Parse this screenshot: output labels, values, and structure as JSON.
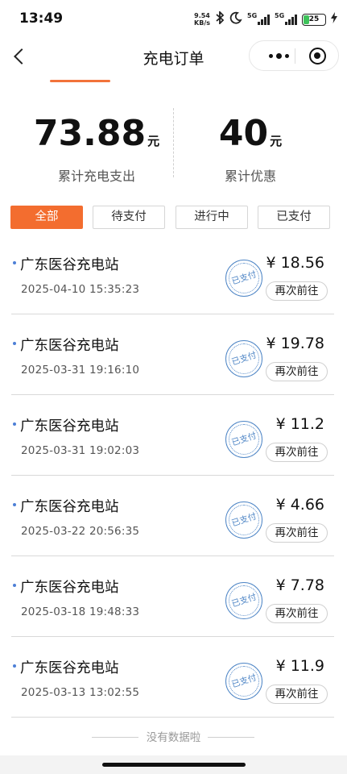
{
  "status_bar": {
    "time": "13:49",
    "net_speed_value": "9.54",
    "net_speed_unit": "KB/s",
    "icons": [
      "bluetooth-icon",
      "moon-icon",
      "signal-icon",
      "signal-icon",
      "battery-icon",
      "charging-icon"
    ],
    "signal_1_label": "5G",
    "signal_2_label": "5G",
    "battery_level": "25"
  },
  "nav": {
    "title": "充电订单"
  },
  "summary": {
    "total_spend_value": "73.88",
    "total_spend_unit": "元",
    "total_spend_label": "累计充电支出",
    "total_discount_value": "40",
    "total_discount_unit": "元",
    "total_discount_label": "累计优惠"
  },
  "filters": {
    "all": "全部",
    "pending_payment": "待支付",
    "in_progress": "进行中",
    "paid": "已支付",
    "active": "全部"
  },
  "colors": {
    "accent": "#f36d2f",
    "stamp": "#4f86c6",
    "dot": "#4d7fd6"
  },
  "orders": [
    {
      "station": "广东医谷充电站",
      "time": "2025-04-10 15:35:23",
      "stamp": "已支付",
      "price": "¥ 18.56",
      "action": "再次前往"
    },
    {
      "station": "广东医谷充电站",
      "time": "2025-03-31 19:16:10",
      "stamp": "已支付",
      "price": "¥ 19.78",
      "action": "再次前往"
    },
    {
      "station": "广东医谷充电站",
      "time": "2025-03-31 19:02:03",
      "stamp": "已支付",
      "price": "¥ 11.2",
      "action": "再次前往"
    },
    {
      "station": "广东医谷充电站",
      "time": "2025-03-22 20:56:35",
      "stamp": "已支付",
      "price": "¥ 4.66",
      "action": "再次前往"
    },
    {
      "station": "广东医谷充电站",
      "time": "2025-03-18 19:48:33",
      "stamp": "已支付",
      "price": "¥ 7.78",
      "action": "再次前往"
    },
    {
      "station": "广东医谷充电站",
      "time": "2025-03-13 13:02:55",
      "stamp": "已支付",
      "price": "¥ 11.9",
      "action": "再次前往"
    }
  ],
  "footer": {
    "no_more_text": "没有数据啦"
  }
}
